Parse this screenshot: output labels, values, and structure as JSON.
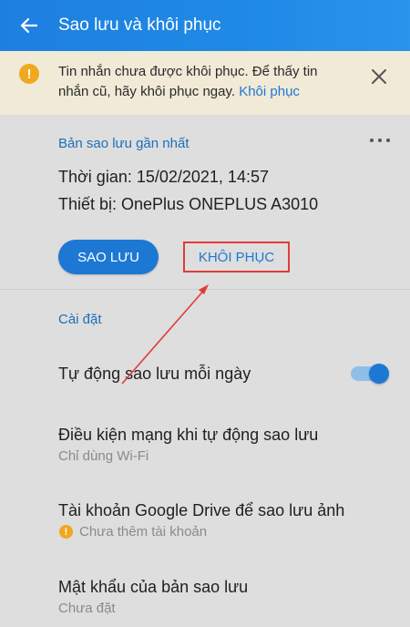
{
  "appbar": {
    "title": "Sao lưu và khôi phục",
    "back_icon": "arrow-left-icon"
  },
  "banner": {
    "message": "Tin nhắn chưa được khôi phục. Để thấy tin nhắn cũ, hãy khôi phục ngay.",
    "link": "Khôi phục",
    "warn_glyph": "!"
  },
  "backup": {
    "section_title": "Bản sao lưu gần nhất",
    "time_line": "Thời gian: 15/02/2021, 14:57",
    "device_line": "Thiết bị: OnePlus ONEPLUS A3010",
    "backup_button": "SAO LƯU",
    "restore_button": "KHÔI PHỤC"
  },
  "settings": {
    "section_title": "Cài đặt",
    "auto_backup": {
      "title": "Tự động sao lưu mỗi ngày",
      "enabled": true
    },
    "network": {
      "title": "Điều kiện mạng khi tự động sao lưu",
      "subtitle": "Chỉ dùng Wi-Fi"
    },
    "drive": {
      "title": "Tài khoản Google Drive để sao lưu ảnh",
      "subtitle": "Chưa thêm tài khoản",
      "warn_glyph": "!"
    },
    "password": {
      "title": "Mật khẩu của bản sao lưu",
      "subtitle": "Chưa đặt"
    }
  },
  "colors": {
    "accent": "#1d78d4",
    "banner_bg": "#f0ead6",
    "warning": "#f0a81e",
    "annotation": "#e03b3b"
  }
}
